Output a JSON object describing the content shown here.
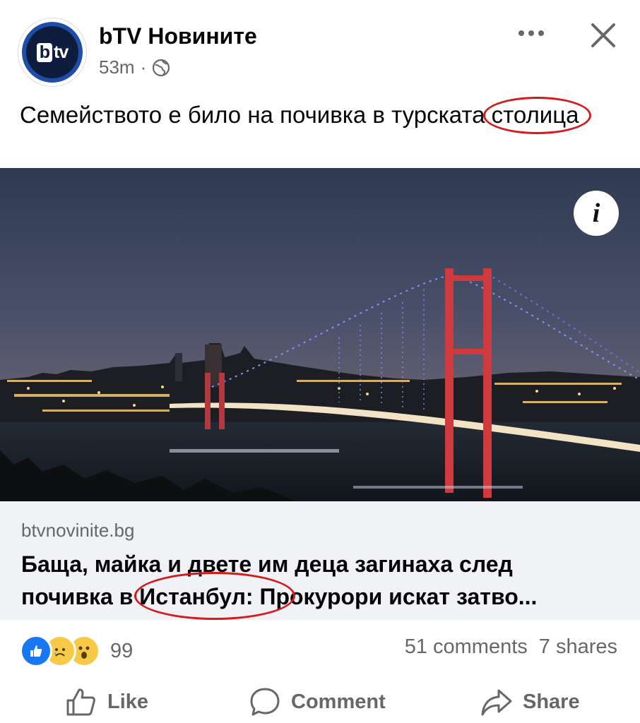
{
  "post": {
    "page_name": "bTV Новините",
    "logo_text_b": "b",
    "logo_text_tv": "tv",
    "time": "53m",
    "separator": "·",
    "caption_main": "Семейството е било на почивка в турската ",
    "caption_marked": "столица"
  },
  "link": {
    "domain": "btvnovinite.bg",
    "title": "Баща, майка и двете им деца загинаха след\nпочивка в Истанбул: Прокурори искат затво..."
  },
  "reactions": {
    "icons": [
      "like-reaction-icon",
      "sad-reaction-icon",
      "wow-reaction-icon"
    ],
    "count": "99",
    "comments": "51 comments",
    "shares": "7 shares"
  },
  "actions": {
    "like": "Like",
    "comment": "Comment",
    "share": "Share"
  },
  "info_button": "i",
  "colors": {
    "text": "#050505",
    "secondary": "#65676b",
    "annotation_red": "#d41a1a",
    "link_bg": "#f0f2f5",
    "like_blue": "#1877f2"
  }
}
